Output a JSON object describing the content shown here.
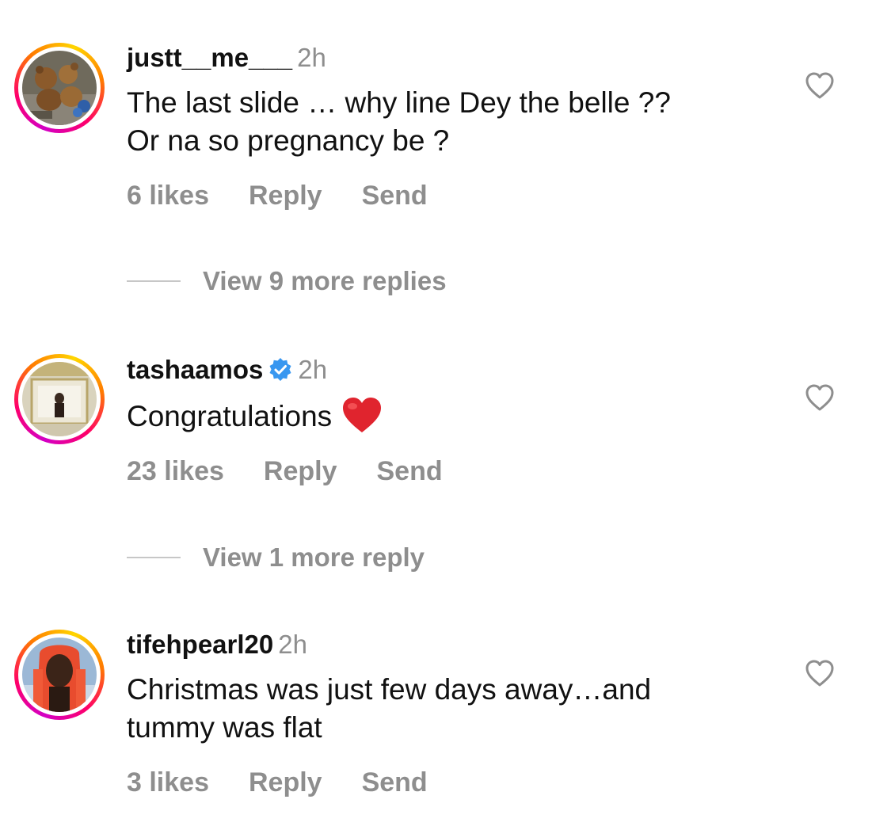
{
  "comments": [
    {
      "username": "justt__me___",
      "time": "2h",
      "verified": false,
      "text_lines": [
        "The last slide … why line Dey the belle ??",
        "Or na so pregnancy be ?"
      ],
      "likes": "6 likes",
      "reply": "Reply",
      "send": "Send",
      "avatar": "teddy-bears-avatar"
    },
    {
      "username": "tashaamos",
      "time": "2h",
      "verified": true,
      "text_lines": [
        "Congratulations"
      ],
      "emoji": "red-heart",
      "likes": "23 likes",
      "reply": "Reply",
      "send": "Send",
      "avatar": "mirror-selfie-avatar"
    },
    {
      "username": "tifehpearl20",
      "time": "2h",
      "verified": false,
      "text_lines": [
        "Christmas was just few days away…and",
        "tummy was flat"
      ],
      "likes": "3 likes",
      "reply": "Reply",
      "send": "Send",
      "avatar": "portrait-avatar"
    }
  ],
  "view_more": [
    {
      "label": "View 9 more replies"
    },
    {
      "label": "View 1 more reply"
    }
  ],
  "colors": {
    "text": "#111111",
    "secondary": "#8e8e8e",
    "verified_blue": "#3897f0",
    "heart_red": "#e0242e"
  }
}
